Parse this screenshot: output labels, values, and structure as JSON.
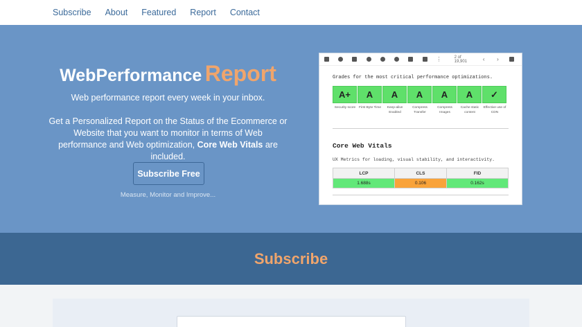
{
  "nav": {
    "items": [
      {
        "label": "Subscribe"
      },
      {
        "label": "About"
      },
      {
        "label": "Featured"
      },
      {
        "label": "Report"
      },
      {
        "label": "Contact"
      }
    ]
  },
  "hero": {
    "brand_main": "WebPerformance",
    "brand_accent": "Report",
    "tagline": "Web performance report every week in your inbox.",
    "desc_part1": "Get a Personalized Report on the Status of the Ecommerce or Website that you want to monitor in terms of Web performance and Web optimization,",
    "desc_bold": "Core Web Vitals",
    "desc_part2": "are included.",
    "button_label": "Subscribe Free",
    "subtext": "Measure, Monitor and Improve..."
  },
  "preview": {
    "count": "2 of 19,901",
    "grades_title": "Grades for the most critical performance optimizations.",
    "grades": [
      {
        "grade": "A+",
        "label": "Security score"
      },
      {
        "grade": "A",
        "label": "First Byte Time"
      },
      {
        "grade": "A",
        "label": "Keep-alive Enabled"
      },
      {
        "grade": "A",
        "label": "Compress Transfer"
      },
      {
        "grade": "A",
        "label": "Compress Images"
      },
      {
        "grade": "A",
        "label": "Cache static content"
      },
      {
        "grade": "✓",
        "label": "Effective use of CDN"
      }
    ],
    "cwv_title": "Core Web Vitals",
    "cwv_subtitle": "UX Metrics for loading, visual stability, and interactivity.",
    "cwv_headers": [
      "LCP",
      "CLS",
      "FID"
    ],
    "cwv_values": [
      "1.688s",
      "0.106",
      "0.162s"
    ],
    "cwv_status_colors": [
      "#62e879",
      "#f9a33a",
      "#62e879"
    ]
  },
  "subscribe": {
    "heading": "Subscribe"
  },
  "colors": {
    "hero_bg": "#6a95c6",
    "band_bg": "#3c6792",
    "accent": "#f0a56c",
    "grade_green": "#5fe06a"
  }
}
